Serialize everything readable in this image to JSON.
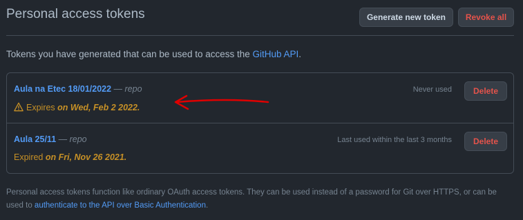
{
  "header": {
    "title": "Personal access tokens",
    "generate_label": "Generate new token",
    "revoke_label": "Revoke all"
  },
  "intro": {
    "text": "Tokens you have generated that can be used to access the ",
    "link": "GitHub API",
    "suffix": "."
  },
  "tokens": [
    {
      "name": "Aula na Etec 18/01/2022",
      "separator": " — ",
      "scope": "repo",
      "expiry_prefix": "Expires ",
      "expiry_date": "on Wed, Feb 2 2022.",
      "last_used": "Never used",
      "delete_label": "Delete"
    },
    {
      "name": "Aula 25/11",
      "separator": " — ",
      "scope": "repo",
      "expiry_prefix": "Expired ",
      "expiry_date": "on Fri, Nov 26 2021.",
      "last_used": "Last used within the last 3 months",
      "delete_label": "Delete"
    }
  ],
  "footer": {
    "text": "Personal access tokens function like ordinary OAuth access tokens. They can be used instead of a password for Git over HTTPS, or can be used to ",
    "link": "authenticate to the API over Basic Authentication",
    "suffix": "."
  },
  "colors": {
    "background": "#22272e",
    "link": "#539bf5",
    "danger": "#e5534b",
    "warning": "#c69026",
    "annotation_arrow": "#e00000"
  },
  "icons": [
    "alert-icon",
    "annotation-arrow"
  ]
}
